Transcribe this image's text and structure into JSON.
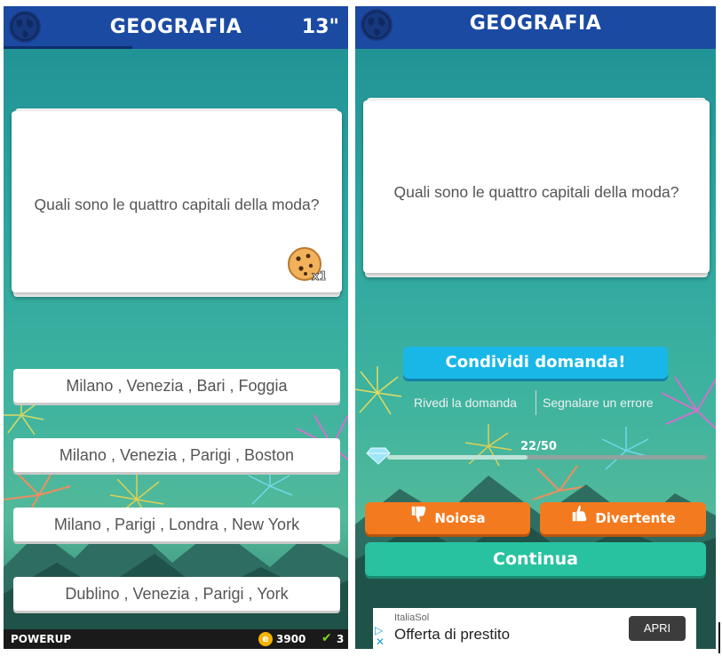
{
  "left": {
    "category": "GEOGRAFIA",
    "timer": "13\"",
    "question": "Quali sono le quattro capitali della moda?",
    "cookie_badge": "x1",
    "answers": [
      "Milano , Venezia , Bari , Foggia",
      "Milano , Venezia , Parigi , Boston",
      "Milano , Parigi , Londra , New York",
      "Dublino , Venezia , Parigi , York"
    ],
    "bottom": {
      "powerup_label": "POWERUP",
      "coins": "3900",
      "correct_count": "3"
    }
  },
  "right": {
    "category": "GEOGRAFIA",
    "question": "Quali sono le quattro capitali della moda?",
    "share_label": "Condividi domanda!",
    "review_link": "Rivedi la domanda",
    "report_link": "Segnalare un errore",
    "progress": {
      "text": "22/50",
      "fraction": 0.44
    },
    "boring_label": "Noiosa",
    "fun_label": "Divertente",
    "continue_label": "Continua",
    "ad": {
      "advertiser": "ItaliaSol",
      "headline": "Offerta di prestito",
      "cta": "APRI"
    }
  },
  "colors": {
    "header_blue": "#1b4aa3",
    "share_cyan": "#19b7e8",
    "orange": "#f47a1f",
    "continue_teal": "#29c2a0",
    "coin_gold": "#f5b300",
    "check_green": "#7ed321"
  },
  "icons": [
    "globe-icon",
    "cookie-icon",
    "coin-icon",
    "check-icon",
    "diamond-icon",
    "thumbs-down-icon",
    "thumbs-up-icon",
    "adchoices-icon",
    "close-icon"
  ]
}
